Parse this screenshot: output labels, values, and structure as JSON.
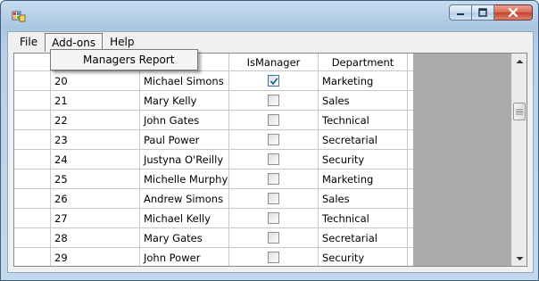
{
  "menubar": {
    "items": [
      {
        "label": "File"
      },
      {
        "label": "Add-ons"
      },
      {
        "label": "Help"
      }
    ]
  },
  "addons_menu": {
    "items": [
      {
        "label": "Managers Report"
      }
    ]
  },
  "grid": {
    "columns": [
      "",
      "",
      "IsManager",
      "Department"
    ],
    "rows": [
      {
        "id": "20",
        "name": "Michael Simons",
        "is_manager": true,
        "department": "Marketing"
      },
      {
        "id": "21",
        "name": "Mary Kelly",
        "is_manager": false,
        "department": "Sales"
      },
      {
        "id": "22",
        "name": "John Gates",
        "is_manager": false,
        "department": "Technical"
      },
      {
        "id": "23",
        "name": "Paul Power",
        "is_manager": false,
        "department": "Secretarial"
      },
      {
        "id": "24",
        "name": "Justyna O'Reilly",
        "is_manager": false,
        "department": "Security"
      },
      {
        "id": "25",
        "name": "Michelle Murphy",
        "is_manager": false,
        "department": "Marketing"
      },
      {
        "id": "26",
        "name": "Andrew Simons",
        "is_manager": false,
        "department": "Sales"
      },
      {
        "id": "27",
        "name": "Michael Kelly",
        "is_manager": false,
        "department": "Technical"
      },
      {
        "id": "28",
        "name": "Mary Gates",
        "is_manager": false,
        "department": "Secretarial"
      },
      {
        "id": "29",
        "name": "John Power",
        "is_manager": false,
        "department": "Security"
      }
    ]
  },
  "icons": {
    "app": "app-icon",
    "minimize": "minimize-icon",
    "maximize": "maximize-icon",
    "close": "close-icon",
    "scroll_up": "scroll-up-icon",
    "scroll_down": "scroll-down-icon",
    "checkmark": "checkmark-icon"
  },
  "colors": {
    "checkmark": "#2a5ea8",
    "grid_empty": "#ababab",
    "close_button": "#c4422b"
  }
}
